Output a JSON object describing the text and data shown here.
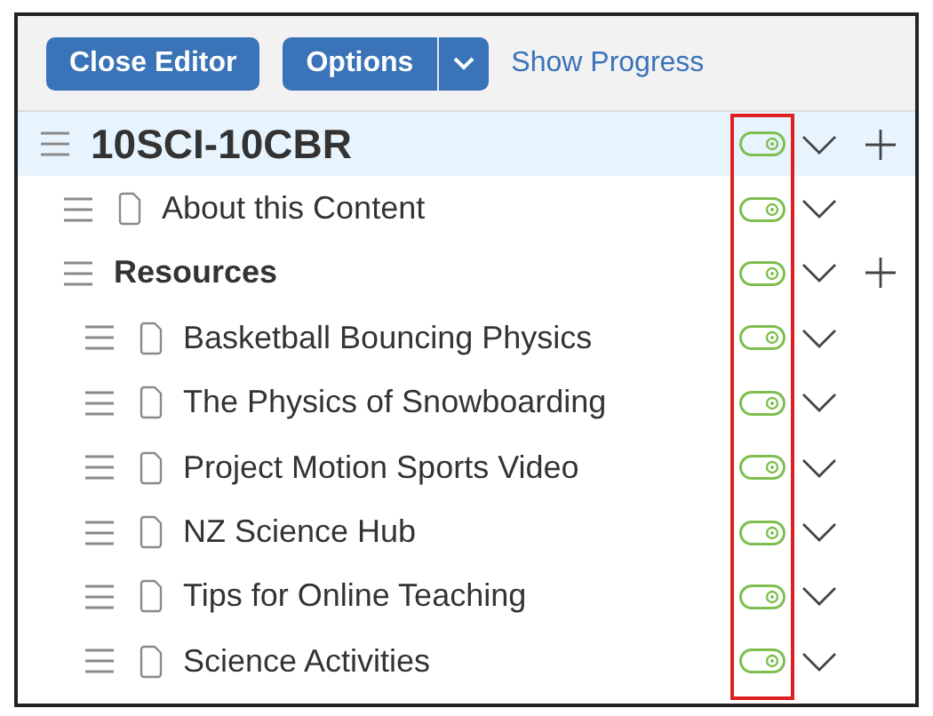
{
  "toolbar": {
    "close_button": "Close Editor",
    "options_button": "Options",
    "progress_link": "Show Progress"
  },
  "tree": [
    {
      "title": "10SCI-10CBR",
      "kind": "course",
      "selected": true,
      "on": true,
      "children": [
        {
          "title": "About this Content",
          "kind": "page",
          "selected": false,
          "on": true
        },
        {
          "title": "Resources",
          "kind": "folder",
          "selected": false,
          "on": true,
          "children": [
            {
              "title": "Basketball Bouncing Physics",
              "kind": "page",
              "selected": false,
              "on": true
            },
            {
              "title": "The Physics of Snowboarding",
              "kind": "page",
              "selected": false,
              "on": true
            },
            {
              "title": "Project Motion Sports Video",
              "kind": "page",
              "selected": false,
              "on": true
            },
            {
              "title": "NZ Science Hub",
              "kind": "page",
              "selected": false,
              "on": true
            },
            {
              "title": "Tips for Online Teaching",
              "kind": "page",
              "selected": false,
              "on": true
            },
            {
              "title": "Science Activities",
              "kind": "page",
              "selected": false,
              "on": true
            }
          ]
        }
      ]
    }
  ]
}
